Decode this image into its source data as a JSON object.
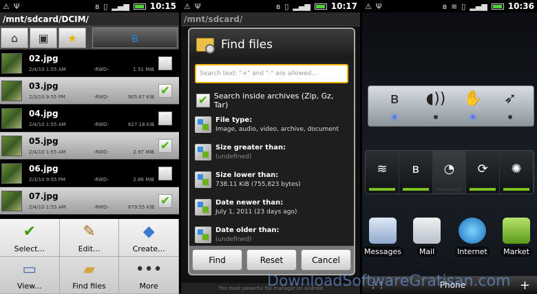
{
  "status": {
    "p1_time": "10:15",
    "p2_time": "10:17",
    "p3_time": "10:36"
  },
  "file_manager": {
    "path": "/mnt/sdcard/DCIM/",
    "tabs": [
      "home-icon",
      "device-icon",
      "favorites-star-icon",
      "bluetooth-icon"
    ],
    "files": [
      {
        "name": "02.jpg",
        "date": "2/4/10  1:55 AM",
        "perm": "-RWD-",
        "size": "1.51 MiB",
        "checked": false
      },
      {
        "name": "03.jpg",
        "date": "2/3/10  9:55 PM",
        "perm": "-RWD-",
        "size": "905.87 KiB",
        "checked": true
      },
      {
        "name": "04.jpg",
        "date": "2/4/10  1:55 AM",
        "perm": "-RWD-",
        "size": "627.18 KiB",
        "checked": false
      },
      {
        "name": "05.jpg",
        "date": "2/4/10  1:55 AM",
        "perm": "-RWD-",
        "size": "2.97 MiB",
        "checked": true
      },
      {
        "name": "06.jpg",
        "date": "2/3/10  9:55 PM",
        "perm": "-RWD-",
        "size": "2.86 MiB",
        "checked": false
      },
      {
        "name": "07.jpg",
        "date": "2/4/10  1:55 AM",
        "perm": "-RWD-",
        "size": "679.55 KiB",
        "checked": true
      }
    ],
    "menu": [
      "Select...",
      "Edit...",
      "Create...",
      "View...",
      "Find files",
      "More"
    ]
  },
  "find_dialog": {
    "path": "/mnt/sdcard/",
    "title": "Find files",
    "search_placeholder": "Search text: \"+\" and \"-\" are allowed...",
    "archive_label": "Search inside archives (Zip, Gz, Tar)",
    "archive_checked": true,
    "criteria": [
      {
        "title": "File type:",
        "value": "Image, audio, video, archive, document",
        "undefined": false
      },
      {
        "title": "Size greater than:",
        "value": "(undefined)",
        "undefined": true
      },
      {
        "title": "Size lower than:",
        "value": "738.11 KiB (755,823 bytes)",
        "undefined": false
      },
      {
        "title": "Date newer than:",
        "value": "July 1, 2011 (23 days ago)",
        "undefined": false
      },
      {
        "title": "Date older than:",
        "value": "(undefined)",
        "undefined": true
      }
    ],
    "buttons": {
      "find": "Find",
      "reset": "Reset",
      "cancel": "Cancel"
    },
    "background_caption": "The most powerful file manager on Android"
  },
  "home_screen": {
    "toggles_top": [
      "bluetooth-icon",
      "audio-icon",
      "hand-icon",
      "cursor-icon"
    ],
    "toggles_top_state": [
      true,
      false,
      true,
      false
    ],
    "toggles_bottom": [
      {
        "icon": "wifi-icon",
        "glyph": "≋",
        "on": true
      },
      {
        "icon": "bluetooth-icon",
        "glyph": "ʙ",
        "on": true
      },
      {
        "icon": "gps-icon",
        "glyph": "◔",
        "on": false
      },
      {
        "icon": "sync-icon",
        "glyph": "⟳",
        "on": true
      },
      {
        "icon": "brightness-icon",
        "glyph": "✺",
        "on": true
      }
    ],
    "dock": [
      "Messages",
      "Mail",
      "Internet",
      "Market"
    ],
    "bottom_phone": "Phone"
  },
  "watermark": "DownloadSoftwareGratisan.com"
}
